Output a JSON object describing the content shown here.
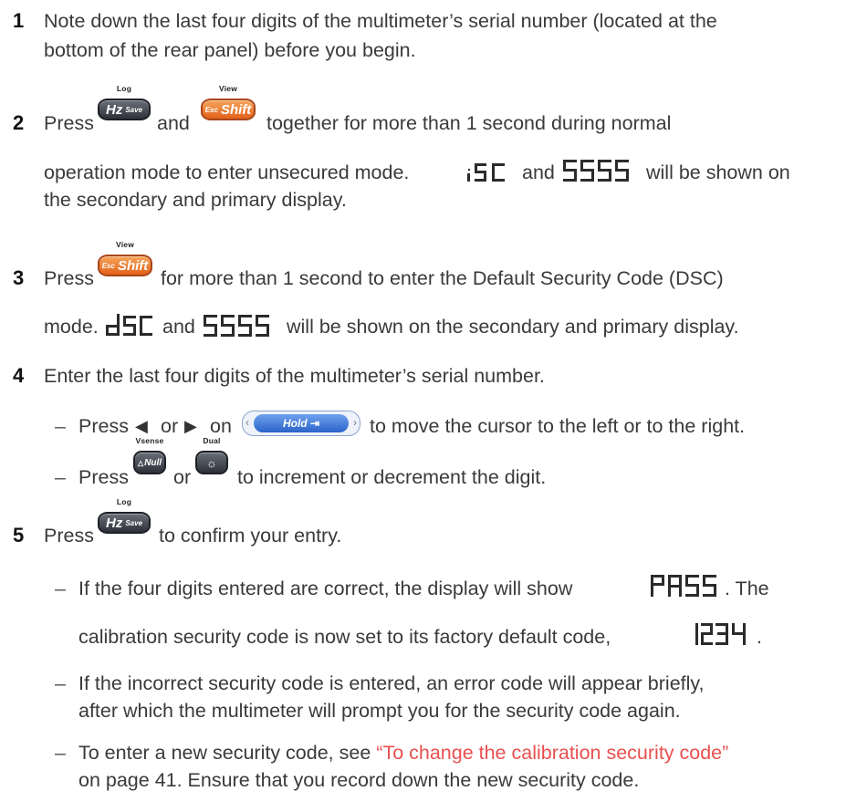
{
  "steps": [
    {
      "number": "1",
      "lines": [
        "Note down the last four digits of the multimeter’s serial number (located at the",
        "bottom of the rear panel) before you begin."
      ]
    },
    {
      "number": "2",
      "press": "Press",
      "and": "and",
      "after": "together for more than 1 second during normal",
      "line2_a": "operation mode to enter unsecured mode.",
      "line2_and": "and",
      "line2_b": "will be shown on",
      "line3": "the secondary and primary display.",
      "display_secondary": "iSC",
      "display_primary": "5555"
    },
    {
      "number": "3",
      "press": "Press",
      "after": "for more than 1 second to enter the Default Security Code (DSC)",
      "line2_a": "mode.",
      "line2_and": "and",
      "line2_b": "will be shown on the secondary and primary display.",
      "display_secondary": "dSC",
      "display_primary": "5555"
    },
    {
      "number": "4",
      "text": "Enter the last four digits of the multimeter’s serial number.",
      "bullets": [
        {
          "dash": "–",
          "press": "Press",
          "left_arrow": "◀",
          "or": "or",
          "right_arrow": "▶",
          "on": "on",
          "after": "to move the cursor to the left or to the right."
        },
        {
          "dash": "–",
          "press": "Press",
          "or": "or",
          "after": "to increment or decrement the digit."
        }
      ]
    },
    {
      "number": "5",
      "press": "Press",
      "after": "to confirm your entry.",
      "bullets": [
        {
          "dash": "–",
          "line1": "If the four digits entered are correct, the display will show",
          "line1_end": ". The",
          "line2": "calibration security code is now set to its factory default code,",
          "line2_end": ".",
          "display_pass": "PASS",
          "display_code": "1234"
        },
        {
          "dash": "–",
          "lines": [
            "If the incorrect security code is entered, an error code will appear briefly,",
            "after which the multimeter will prompt you for the security code again."
          ]
        },
        {
          "dash": "–",
          "line1_a": "To enter a new security code, see",
          "link": "“To change the calibration security code”",
          "line2": "on page 41. Ensure that you record down the new security code."
        }
      ]
    }
  ],
  "keys": {
    "hz_save": {
      "top": "Log",
      "main": "Hz",
      "sub": "Save"
    },
    "esc_shift": {
      "top": "View",
      "main": "Shift",
      "sub": "Esc"
    },
    "hold": {
      "main": "Hold"
    },
    "null": {
      "top": "Vsense",
      "main": "Null",
      "sub": "△"
    },
    "backlight": {
      "top": "Dual",
      "main": "☼"
    }
  },
  "colors": {
    "link": "#e8504f",
    "orange_key": "#e2611b",
    "grey_key": "#2e3139",
    "hold_key": "#2a63c9"
  }
}
